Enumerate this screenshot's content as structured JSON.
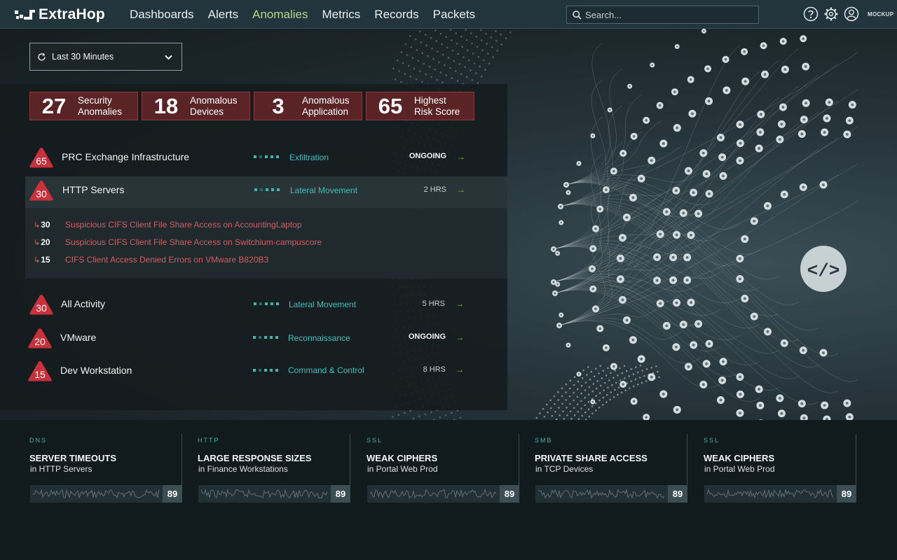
{
  "app": {
    "brand": "ExtraHop",
    "user_label": "MOCKUP"
  },
  "nav": {
    "links": [
      "Dashboards",
      "Alerts",
      "Anomalies",
      "Metrics",
      "Records",
      "Packets"
    ],
    "active": "Anomalies",
    "search_placeholder": "Search..."
  },
  "time_range": {
    "label": "Last 30 Minutes"
  },
  "summary": [
    {
      "value": "27",
      "line1": "Security",
      "line2": "Anomalies"
    },
    {
      "value": "18",
      "line1": "Anomalous",
      "line2": "Devices"
    },
    {
      "value": "3",
      "line1": "Anomalous",
      "line2": "Application"
    },
    {
      "value": "65",
      "line1": "Highest",
      "line2": "Risk Score"
    }
  ],
  "anomalies": [
    {
      "risk": "65",
      "name": "PRC Exchange Infrastructure",
      "tactic": "Exfiltration",
      "time": "ONGOING"
    },
    {
      "risk": "30",
      "name": "HTTP Servers",
      "tactic": "Lateral Movement",
      "time": "2 HRS"
    },
    {
      "risk": "30",
      "name": "All Activity",
      "tactic": "Lateral Movement",
      "time": "5 HRS"
    },
    {
      "risk": "20",
      "name": "VMware",
      "tactic": "Reconnaissance",
      "time": "ONGOING"
    },
    {
      "risk": "15",
      "name": "Dev Workstation",
      "tactic": "Command & Control",
      "time": "8 HRS"
    }
  ],
  "sub_items": [
    {
      "score": "30",
      "description": "Suspicious CIFS Client File Share Access on AccountingLaptop"
    },
    {
      "score": "20",
      "description": "Suspicious CIFS Client File Share Access on Switchium-campuscore"
    },
    {
      "score": "15",
      "description": "CIFS Client Access Denied Errors on VMware B820B3"
    }
  ],
  "metrics": [
    {
      "protocol": "DNS",
      "title": "SERVER TIMEOUTS",
      "subtitle": "in HTTP Servers",
      "score": "89"
    },
    {
      "protocol": "HTTP",
      "title": "LARGE RESPONSE SIZES",
      "subtitle": "in Finance Workstations",
      "score": "89"
    },
    {
      "protocol": "SSL",
      "title": "WEAK CIPHERS",
      "subtitle": "in Portal Web Prod",
      "score": "89"
    },
    {
      "protocol": "SMB",
      "title": "PRIVATE SHARE ACCESS",
      "subtitle": "in TCP Devices",
      "score": "89"
    },
    {
      "protocol": "SSL",
      "title": "WEAK CIPHERS",
      "subtitle": "in Portal Web Prod",
      "score": "89"
    }
  ],
  "colors": {
    "risk_red": "#c8303a",
    "card_red": "#5a2426",
    "teal": "#3fbfbd",
    "nav_active": "#b3d98a",
    "arrow_green": "#8dc43f"
  }
}
